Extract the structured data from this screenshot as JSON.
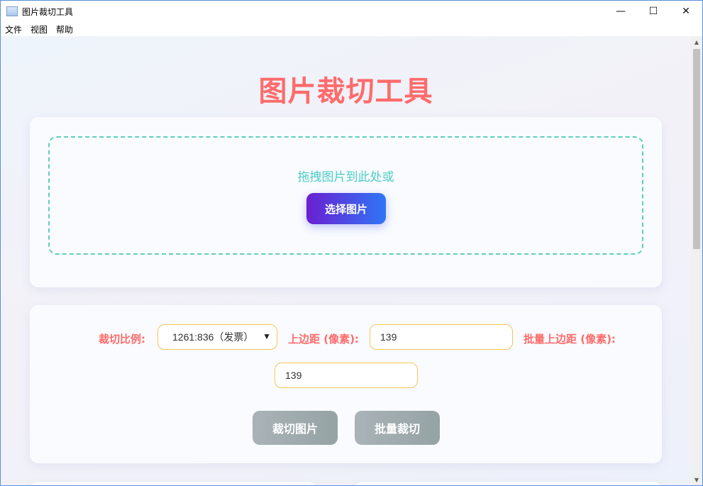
{
  "window": {
    "title": "图片裁切工具",
    "controls": {
      "minimize": "—",
      "maximize": "☐",
      "close": "✕"
    }
  },
  "menu": [
    "文件",
    "视图",
    "帮助"
  ],
  "page": {
    "title": "图片裁切工具"
  },
  "upload": {
    "drop_text": "拖拽图片到此处或",
    "select_button": "选择图片"
  },
  "settings": {
    "crop_ratio_label": "裁切比例:",
    "crop_ratio_value": "1261:836（发票）",
    "top_margin_label": "上边距 (像素):",
    "top_margin_value": "139",
    "batch_top_margin_label": "批量上边距 (像素):",
    "batch_top_margin_value": "139",
    "crop_button": "裁切图片",
    "batch_crop_button": "批量裁切"
  },
  "colors": {
    "title_red": "#ff6b6b",
    "drop_teal": "#4ecdc4",
    "button_gradient": [
      "#6a1fd1",
      "#2f76f5"
    ],
    "input_border": "#f5c65a",
    "disabled_button": "#9fa9ab"
  }
}
